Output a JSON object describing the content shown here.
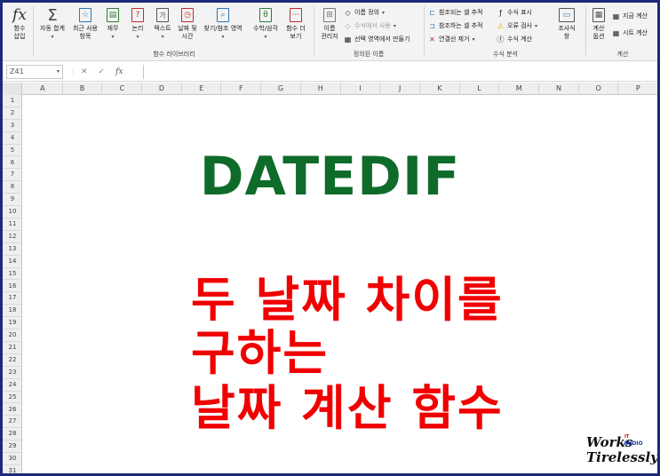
{
  "ribbon": {
    "insert_function": "함수\n삽입",
    "autosum": "자동 합계",
    "recent": "최근 사용\n항목",
    "financial": "재무",
    "logical": "논리",
    "text": "텍스트",
    "datetime": "날짜 및\n시간",
    "lookup": "찾기/참조 영역",
    "math": "수학/삼각",
    "more": "함수 더\n보기",
    "group_function_library": "함수 라이브러리",
    "name_manager": "이름\n관리자",
    "define_name": "이름 정의",
    "use_in_formula": "수식에서 사용",
    "create_from_selection": "선택 영역에서 만들기",
    "group_defined_names": "정의된 이름",
    "trace_precedents": "참조되는 셀 추적",
    "trace_dependents": "참조하는 셀 추적",
    "remove_arrows": "연결선 제거",
    "show_formulas": "수식 표시",
    "error_checking": "오류 검사",
    "evaluate_formula": "수식 계산",
    "group_formula_auditing": "수식 분석",
    "watch_window": "조사식\n창",
    "calc_options": "계산\n옵션",
    "calc_now": "지금 계산",
    "calc_sheet": "시트 계산",
    "group_calculation": "계산"
  },
  "formula_bar": {
    "name_box": "Z41",
    "cancel": "✕",
    "enter": "✓",
    "fx": "fx",
    "value": ""
  },
  "columns": [
    "A",
    "B",
    "C",
    "D",
    "E",
    "F",
    "G",
    "H",
    "I",
    "J",
    "K",
    "L",
    "M",
    "N",
    "O",
    "P"
  ],
  "rows": [
    "1",
    "2",
    "3",
    "4",
    "5",
    "6",
    "7",
    "8",
    "9",
    "10",
    "11",
    "12",
    "13",
    "14",
    "15",
    "16",
    "17",
    "18",
    "19",
    "20",
    "21",
    "22",
    "23",
    "24",
    "25",
    "26",
    "27",
    "28",
    "29",
    "30",
    "31"
  ],
  "overlay": {
    "title": "DATEDIF",
    "line1": "두 날짜 차이를",
    "line2": "구하는",
    "line3": "날짜 계산 함수"
  },
  "logo": {
    "line1": "Works",
    "line2": "Tirelessly",
    "it": "IT",
    "audio": "AUDIO"
  },
  "colors": {
    "title_green": "#0f6b2a",
    "korean_red": "#f00000",
    "frame_border": "#1e2a78"
  }
}
